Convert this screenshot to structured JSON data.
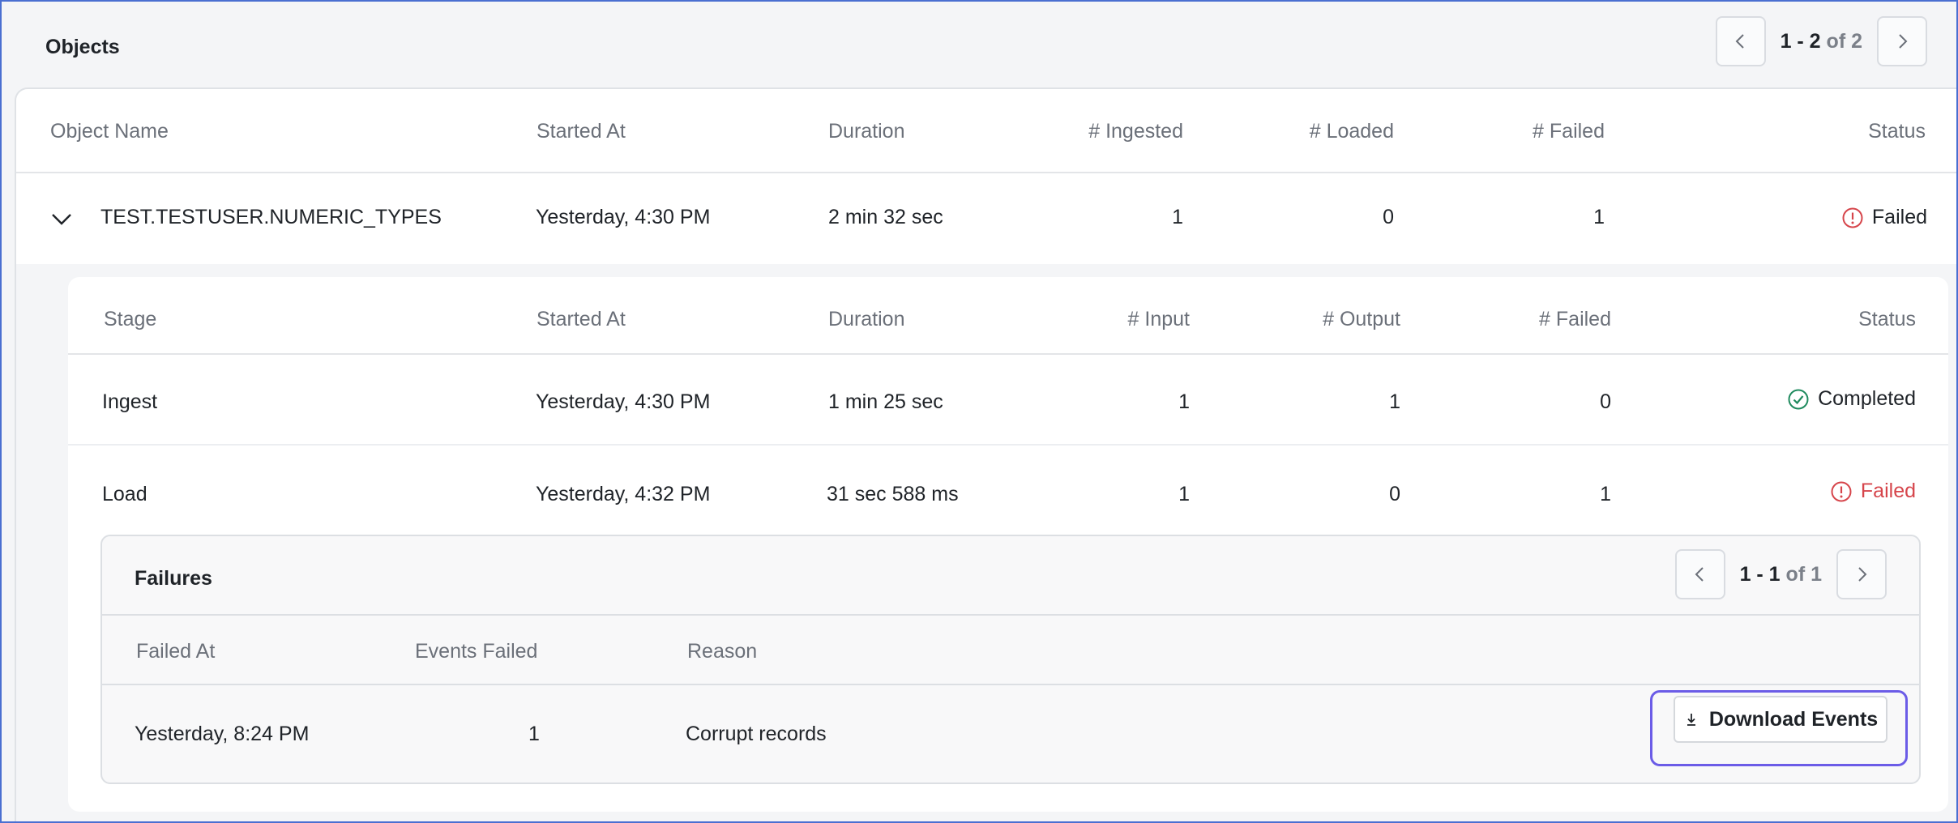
{
  "header": {
    "title": "Objects",
    "pagination": {
      "range": "1 - 2",
      "of": "of 2"
    }
  },
  "objects_table": {
    "columns": [
      "Object Name",
      "Started At",
      "Duration",
      "# Ingested",
      "# Loaded",
      "# Failed",
      "Status"
    ],
    "rows": [
      {
        "name": "TEST.TESTUSER.NUMERIC_TYPES",
        "started_at": "Yesterday, 4:30 PM",
        "duration": "2 min 32 sec",
        "ingested": "1",
        "loaded": "0",
        "failed": "1",
        "status": "Failed"
      }
    ]
  },
  "stages_table": {
    "columns": [
      "Stage",
      "Started At",
      "Duration",
      "# Input",
      "# Output",
      "# Failed",
      "Status"
    ],
    "rows": [
      {
        "stage": "Ingest",
        "started_at": "Yesterday, 4:30 PM",
        "duration": "1 min 25 sec",
        "input": "1",
        "output": "1",
        "failed": "0",
        "status": "Completed"
      },
      {
        "stage": "Load",
        "started_at": "Yesterday, 4:32 PM",
        "duration": "31 sec 588 ms",
        "input": "1",
        "output": "0",
        "failed": "1",
        "status": "Failed"
      }
    ]
  },
  "failures": {
    "title": "Failures",
    "pagination": {
      "range": "1 - 1",
      "of": "of 1"
    },
    "columns": [
      "Failed At",
      "Events Failed",
      "Reason"
    ],
    "rows": [
      {
        "failed_at": "Yesterday, 8:24 PM",
        "events_failed": "1",
        "reason": "Corrupt records"
      }
    ],
    "download_label": "Download Events"
  },
  "colors": {
    "failed": "#d6454b",
    "completed": "#1f8a5e",
    "focus_ring": "#6b5ce7"
  },
  "icons": {
    "prev": "chevron-left-icon",
    "next": "chevron-right-icon",
    "expand": "chevron-down-icon",
    "failed": "alert-circle-icon",
    "completed": "check-circle-icon",
    "download": "download-icon"
  }
}
